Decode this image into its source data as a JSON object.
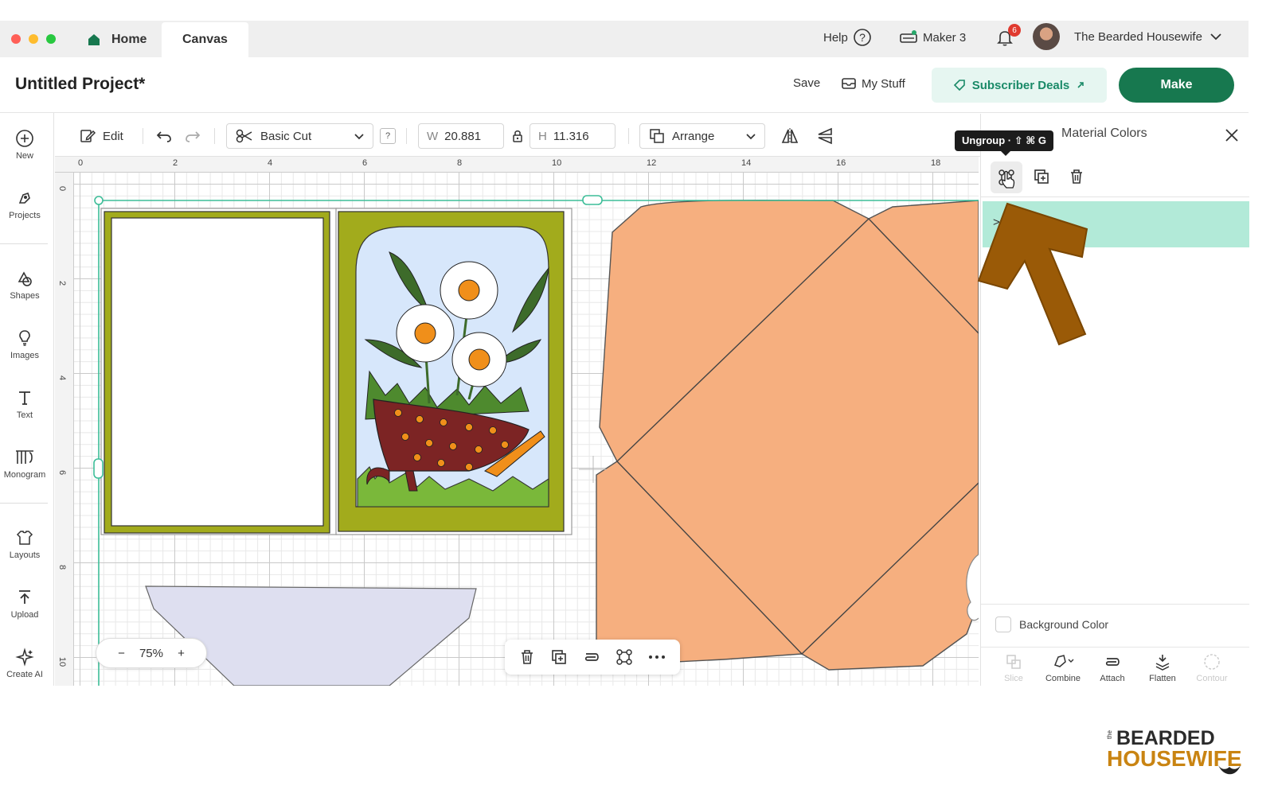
{
  "window": {
    "traffic_lights": [
      "#ff5f57",
      "#febc2e",
      "#28c840"
    ],
    "tabs": [
      {
        "label": "Home",
        "icon": "home-icon"
      },
      {
        "label": "Canvas"
      }
    ]
  },
  "topbar": {
    "help_label": "Help",
    "machine_label": "Maker 3",
    "notifications_count": "6",
    "user_name": "The Bearded Housewife"
  },
  "header": {
    "project_title": "Untitled Project*",
    "save_label": "Save",
    "mystuff_label": "My Stuff",
    "deals_label": "Subscriber Deals",
    "make_label": "Make"
  },
  "sidebar": {
    "items": [
      {
        "label": "New",
        "icon": "plus-circle-icon"
      },
      {
        "label": "Projects",
        "icon": "projects-icon"
      },
      {
        "label": "Shapes",
        "icon": "shapes-icon"
      },
      {
        "label": "Images",
        "icon": "lightbulb-icon"
      },
      {
        "label": "Text",
        "icon": "text-icon"
      },
      {
        "label": "Monogram",
        "icon": "monogram-icon"
      },
      {
        "label": "Layouts",
        "icon": "layouts-icon"
      },
      {
        "label": "Upload",
        "icon": "upload-icon"
      },
      {
        "label": "Create AI",
        "icon": "sparkle-icon"
      }
    ]
  },
  "toolbar": {
    "edit_label": "Edit",
    "operation": "Basic Cut",
    "help_badge": "?",
    "width_label": "W",
    "width_value": "20.881",
    "height_label": "H",
    "height_value": "11.316",
    "arrange_label": "Arrange"
  },
  "canvas": {
    "ruler_top": [
      "0",
      "2",
      "4",
      "6",
      "8",
      "10",
      "12",
      "14",
      "16",
      "18"
    ],
    "ruler_left": [
      "0",
      "2",
      "4",
      "6",
      "8",
      "10"
    ],
    "zoom_minus": "−",
    "zoom_level": "75%",
    "zoom_plus": "+",
    "colors": {
      "card_frame": "#a2ab1c",
      "envelope": "#f6af7f",
      "sky": "#d7e7fb",
      "leaf": "#3d6b2a",
      "wheelbarrow": "#7c2424",
      "dot": "#f08f1a",
      "lavender": "#dedff0",
      "selection": "#3dbd98"
    }
  },
  "right_panel": {
    "title": "Material Colors",
    "tooltip": "Ungroup · ⇧ ⌘ G",
    "layer_arrow": ">",
    "background_color_label": "Background Color",
    "bottom_tools": [
      {
        "label": "Slice",
        "icon": "slice-icon",
        "enabled": false
      },
      {
        "label": "Combine",
        "icon": "combine-icon",
        "enabled": true
      },
      {
        "label": "Attach",
        "icon": "attach-icon",
        "enabled": true
      },
      {
        "label": "Flatten",
        "icon": "flatten-icon",
        "enabled": true
      },
      {
        "label": "Contour",
        "icon": "contour-icon",
        "enabled": false
      }
    ]
  },
  "annotation": {
    "arrow_color": "#9a5a07"
  },
  "watermark": {
    "small": "the",
    "line1": "BEARDED",
    "line2": "HOUSEWIFE"
  }
}
